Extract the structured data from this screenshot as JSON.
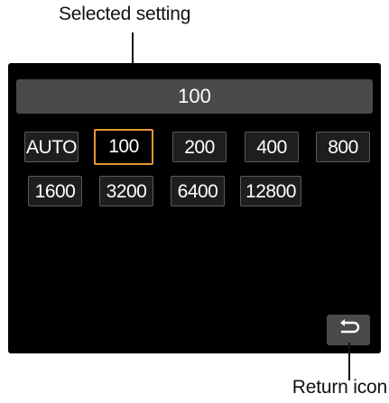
{
  "callouts": {
    "top": "Selected setting",
    "bottom": "Return icon"
  },
  "screen": {
    "current_value": "100",
    "options": [
      "AUTO",
      "100",
      "200",
      "400",
      "800",
      "1600",
      "3200",
      "6400",
      "12800"
    ],
    "selected_option": "100"
  },
  "colors": {
    "selection_border": "#e89530",
    "value_bar": "#4a4a4a",
    "screen_bg": "#000000"
  },
  "icons": {
    "return": "return-icon"
  }
}
